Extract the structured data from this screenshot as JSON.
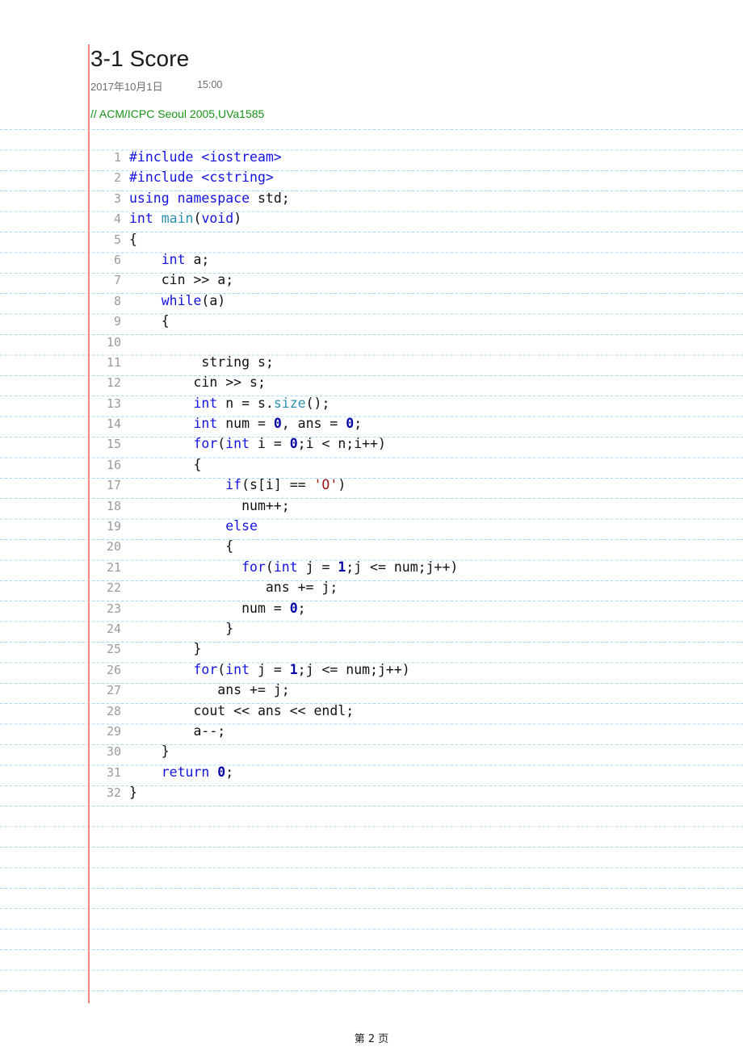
{
  "document": {
    "title": "3-1 Score",
    "date": "2017年10月1日",
    "time": "15:00",
    "source_comment": "// ACM/ICPC Seoul 2005,UVa1585",
    "footer": "第 2 页"
  },
  "theme": {
    "rule_line_color": "#96CDEB",
    "margin_line_color": "#F98781",
    "comment_color": "#169416",
    "keyword_color": "#1414E0",
    "function_color": "#2B91AF",
    "number_color": "#0505A5",
    "string_color": "#9B1212",
    "line_number_color": "#9B9B9B",
    "code_color": "#111111",
    "page_background": "#FFFFFF"
  },
  "code": {
    "language": "cpp",
    "first_line_number": 1,
    "total_lines": 32,
    "lines": [
      {
        "n": "1",
        "html": "<span class=\"pp\">#include &lt;iostream&gt;</span>"
      },
      {
        "n": "2",
        "html": "<span class=\"pp\">#include &lt;cstring&gt;</span>"
      },
      {
        "n": "3",
        "html": "<span class=\"kw\">using namespace</span> std;"
      },
      {
        "n": "4",
        "html": "<span class=\"kw\">int</span> <span class=\"fn\">main</span>(<span class=\"kw\">void</span>)"
      },
      {
        "n": "5",
        "html": "{"
      },
      {
        "n": "6",
        "html": "    <span class=\"kw\">int</span> a;"
      },
      {
        "n": "7",
        "html": "    cin &gt;&gt; a;"
      },
      {
        "n": "8",
        "html": "    <span class=\"kw\">while</span>(a)"
      },
      {
        "n": "9",
        "html": "    {"
      },
      {
        "n": "10",
        "html": ""
      },
      {
        "n": "11",
        "html": "         string s;"
      },
      {
        "n": "12",
        "html": "        cin &gt;&gt; s;"
      },
      {
        "n": "13",
        "html": "        <span class=\"kw\">int</span> n = s.<span class=\"fn\">size</span>();"
      },
      {
        "n": "14",
        "html": "        <span class=\"kw\">int</span> num = <span class=\"num\">0</span>, ans = <span class=\"num\">0</span>;"
      },
      {
        "n": "15",
        "html": "        <span class=\"kw\">for</span>(<span class=\"kw\">int</span> i = <span class=\"num\">0</span>;i &lt; n;i++)"
      },
      {
        "n": "16",
        "html": "        {"
      },
      {
        "n": "17",
        "html": "            <span class=\"kw\">if</span>(s[i] == <span class=\"str\">'O'</span>)"
      },
      {
        "n": "18",
        "html": "              num++;"
      },
      {
        "n": "19",
        "html": "            <span class=\"kw\">else</span>"
      },
      {
        "n": "20",
        "html": "            {"
      },
      {
        "n": "21",
        "html": "              <span class=\"kw\">for</span>(<span class=\"kw\">int</span> j = <span class=\"num\">1</span>;j &lt;= num;j++)"
      },
      {
        "n": "22",
        "html": "                 ans += j;"
      },
      {
        "n": "23",
        "html": "              num = <span class=\"num\">0</span>;"
      },
      {
        "n": "24",
        "html": "            }"
      },
      {
        "n": "25",
        "html": "        }"
      },
      {
        "n": "26",
        "html": "        <span class=\"kw\">for</span>(<span class=\"kw\">int</span> j = <span class=\"num\">1</span>;j &lt;= num;j++)"
      },
      {
        "n": "27",
        "html": "           ans += j;"
      },
      {
        "n": "28",
        "html": "        cout &lt;&lt; ans &lt;&lt; endl;"
      },
      {
        "n": "29",
        "html": "        a--;"
      },
      {
        "n": "30",
        "html": "    }"
      },
      {
        "n": "31",
        "html": "    <span class=\"kw\">return</span> <span class=\"num\">0</span>;"
      },
      {
        "n": "32",
        "html": "}"
      }
    ]
  }
}
